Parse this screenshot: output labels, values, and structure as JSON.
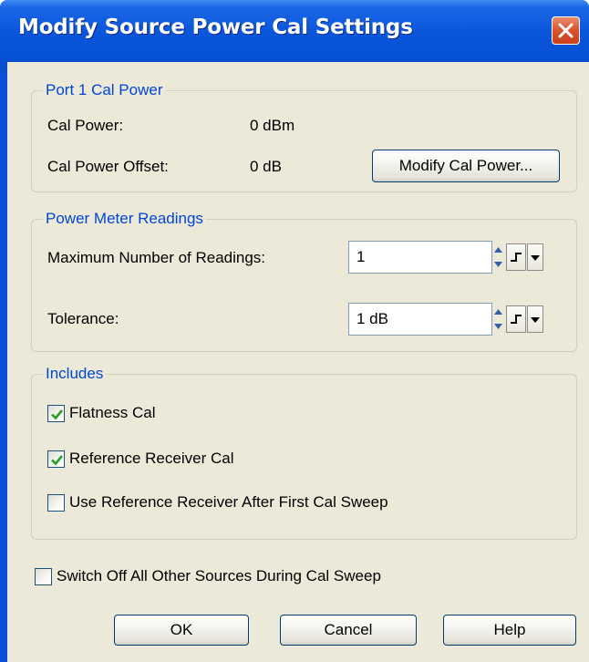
{
  "window": {
    "title": "Modify Source Power Cal Settings",
    "close_icon": "close-x-icon",
    "title_bar_color": "#0a56db",
    "close_button_color": "#d9532c"
  },
  "port_cal_power": {
    "legend": "Port 1 Cal Power",
    "cal_power_label": "Cal Power:",
    "cal_power_value": "0 dBm",
    "cal_power_offset_label": "Cal Power Offset:",
    "cal_power_offset_value": "0 dB",
    "modify_button_label": "Modify Cal Power..."
  },
  "power_meter": {
    "legend": "Power Meter Readings",
    "max_readings_label": "Maximum Number of Readings:",
    "max_readings_value": "1",
    "tolerance_label": "Tolerance:",
    "tolerance_value": "1 dB",
    "spinner_icon": "up-down-spinner-icon",
    "step_icon": "step-size-icon",
    "dropdown_icon": "dropdown-arrow-icon"
  },
  "includes": {
    "legend": "Includes",
    "options": [
      {
        "label": "Flatness Cal",
        "checked": true
      },
      {
        "label": "Reference Receiver Cal",
        "checked": true
      },
      {
        "label": "Use Reference Receiver After First Cal Sweep",
        "checked": false
      }
    ],
    "check_color": "#21a121"
  },
  "switch_off": {
    "label": "Switch Off All Other Sources During Cal Sweep",
    "checked": false
  },
  "buttons": {
    "ok": "OK",
    "cancel": "Cancel",
    "help": "Help"
  },
  "legend_color": "#0046d5"
}
